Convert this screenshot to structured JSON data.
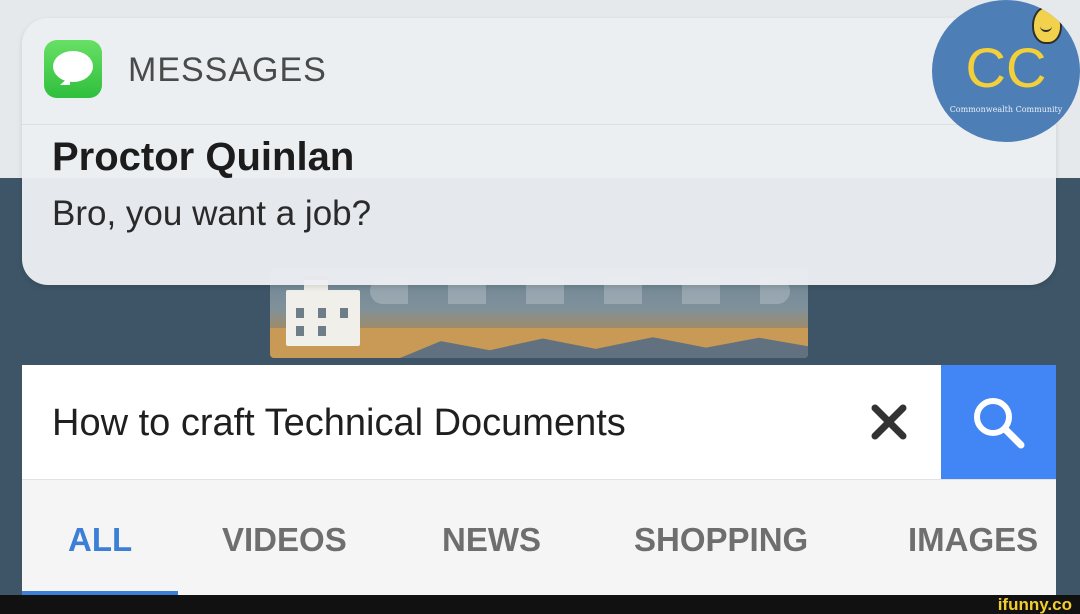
{
  "notification": {
    "app_name": "MESSAGES",
    "sender": "Proctor Quinlan",
    "message": "Bro, you want a job?"
  },
  "logo": {
    "text": "CC",
    "subtext": "Commonwealth Community"
  },
  "search": {
    "query": "How to craft Technical Documents"
  },
  "tabs": [
    {
      "label": "ALL",
      "active": true
    },
    {
      "label": "VIDEOS",
      "active": false
    },
    {
      "label": "NEWS",
      "active": false
    },
    {
      "label": "SHOPPING",
      "active": false
    },
    {
      "label": "IMAGES",
      "active": false
    }
  ],
  "watermark": "ifunny.co",
  "colors": {
    "accent": "#4285f4",
    "active_tab": "#3b7fd6",
    "messages_green": "#3ac94a",
    "logo_blue": "#4d7fb6",
    "logo_yellow": "#f3cf3a"
  }
}
